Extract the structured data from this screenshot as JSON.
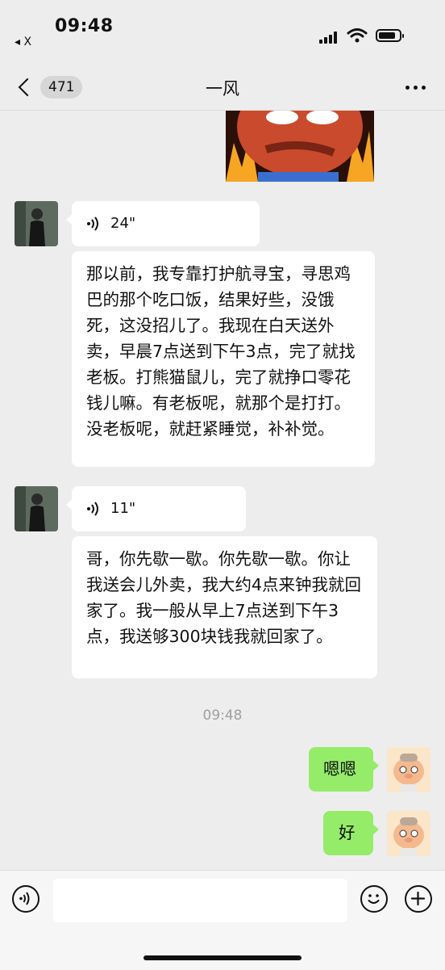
{
  "status_bar": {
    "time": "09:48",
    "back_app": "◂ X"
  },
  "header": {
    "unread_count": "471",
    "title": "一风"
  },
  "messages": {
    "voice1_duration": "24\"",
    "text1": "那以前，我专靠打护航寻宝，寻思鸡巴的那个吃口饭，结果好些，没饿死，这没招儿了。我现在白天送外卖，早晨7点送到下午3点，完了就找老板。打熊猫鼠儿，完了就挣口零花钱儿嘛。有老板呢，就那个是打打。没老板呢，就赶紧睡觉，补补觉。",
    "voice2_duration": "11\"",
    "text2": "哥，你先歇一歇。你先歇一歇。你让我送会儿外卖，我大约4点来钟我就回家了。我一般从早上7点送到下午3点，我送够300块钱我就回家了。",
    "timestamp": "09:48",
    "reply1": "嗯嗯",
    "reply2": "好"
  },
  "icons": {
    "back": "chevron-left-icon",
    "more": "more-dots-icon",
    "voice": "voice-wave-icon",
    "emoji": "emoji-icon",
    "add": "plus-circle-icon"
  },
  "colors": {
    "background": "#ededed",
    "outgoing_bubble": "#95ec69",
    "incoming_bubble": "#ffffff"
  }
}
